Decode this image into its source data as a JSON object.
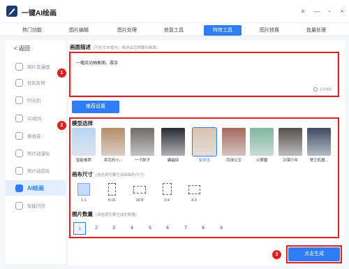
{
  "app": {
    "title": "一键AI绘画"
  },
  "window_controls": {
    "menu": "≡",
    "minimize": "—",
    "maximize": "▫",
    "close": "×"
  },
  "tabs": [
    {
      "label": "热门功能"
    },
    {
      "label": "图片编辑"
    },
    {
      "label": "图片处理"
    },
    {
      "label": "修复工具"
    },
    {
      "label": "特效工具",
      "active": true
    },
    {
      "label": "图片转换"
    },
    {
      "label": "批量处理"
    }
  ],
  "sidebar": {
    "back_label": "< 返回",
    "items": [
      {
        "label": "照片变漫画",
        "icon": "portrait-icon"
      },
      {
        "label": "性别反转",
        "icon": "gender-icon"
      },
      {
        "label": "时光机",
        "icon": "clock-icon"
      },
      {
        "label": "3D相片",
        "icon": "cube-icon"
      },
      {
        "label": "换妆容",
        "icon": "makeup-icon"
      },
      {
        "label": "照片动漫化",
        "icon": "anime-icon"
      },
      {
        "label": "照片动态化",
        "icon": "motion-icon"
      },
      {
        "label": "AI绘画",
        "icon": "ai-paint-icon",
        "active": true
      },
      {
        "label": "智能问答",
        "icon": "chat-icon"
      }
    ]
  },
  "description": {
    "title": "画面描述",
    "hint": "(可在文本框内，描述出您想要的画面)",
    "value": "一幅流动抽象图，震余",
    "count": "10/300"
  },
  "recommend_button": "推荐设置",
  "model_select": {
    "title": "模型选择",
    "models": [
      {
        "label": "智能推荐",
        "color": "#b9d6f6"
      },
      {
        "label": "卖花的小...",
        "color": "#b58c6a"
      },
      {
        "label": "一个胖子",
        "color": "#6e6a66"
      },
      {
        "label": "蝙蝠侠",
        "color": "#2a2c31"
      },
      {
        "label": "女学生",
        "color": "#d8c3ad",
        "selected": true
      },
      {
        "label": "月球公主",
        "color": "#a4695c"
      },
      {
        "label": "小萝魔",
        "color": "#7fb7a0"
      },
      {
        "label": "冷漠少年",
        "color": "#55504d"
      },
      {
        "label": "警卫机器...",
        "color": "#3d4a63"
      }
    ]
  },
  "canvas_size": {
    "title": "画布尺寸",
    "hint": "(请选择您要生成画面的尺寸)",
    "ratios": [
      {
        "label": "1:1",
        "selected": true
      },
      {
        "label": "9:16"
      },
      {
        "label": "16:9"
      },
      {
        "label": "3:4"
      },
      {
        "label": "4:3"
      }
    ]
  },
  "image_count": {
    "title": "图片数量",
    "hint": "(请选择您要生成的数量)",
    "options": [
      "1",
      "2",
      "3",
      "4",
      "5",
      "6",
      "7",
      "8",
      "9"
    ],
    "selected": "1"
  },
  "generate_button": "点击生成",
  "annotations": [
    "1",
    "2",
    "3"
  ]
}
